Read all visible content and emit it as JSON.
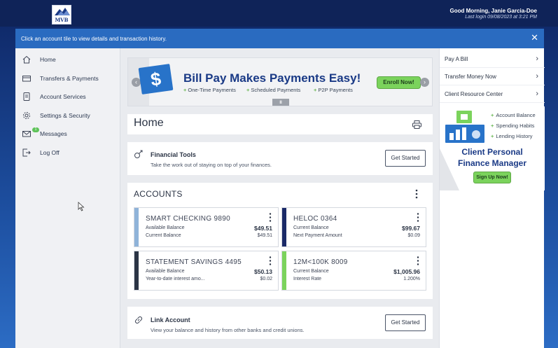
{
  "header": {
    "logo_text": "MVB",
    "greeting": "Good Morning, Janie Garcia-Doe",
    "last_login": "Last login 09/08/2023 at 3:21 PM"
  },
  "notice": {
    "text": "Click an account tile to view details and transaction history.",
    "close_glyph": "✕"
  },
  "sidebar": {
    "items": [
      {
        "label": "Home",
        "icon": "home-icon"
      },
      {
        "label": "Transfers & Payments",
        "icon": "card-icon"
      },
      {
        "label": "Account Services",
        "icon": "document-icon"
      },
      {
        "label": "Settings & Security",
        "icon": "gear-icon"
      },
      {
        "label": "Messages",
        "icon": "envelope-icon",
        "badge": "1"
      },
      {
        "label": "Log Off",
        "icon": "logout-icon"
      }
    ]
  },
  "banner": {
    "title": "Bill Pay Makes Payments Easy!",
    "bullets": [
      "One-Time Payments",
      "Scheduled Payments",
      "P2P Payments"
    ],
    "cta": "Enroll Now!",
    "pause": "II",
    "dollar": "$",
    "prev": "‹",
    "next": "›"
  },
  "home": {
    "title": "Home"
  },
  "financial_tools": {
    "title": "Financial Tools",
    "subtitle": "Take the work out of staying on top of your finances.",
    "button": "Get Started"
  },
  "accounts": {
    "heading": "ACCOUNTS",
    "tiles": [
      {
        "name": "SMART CHECKING 9890",
        "label1": "Available Balance",
        "value1": "$49.51",
        "label2": "Current Balance",
        "value2": "$49.51",
        "color": "#8fb3d9"
      },
      {
        "name": "HELOC 0364",
        "label1": "Current Balance",
        "value1": "$99.67",
        "label2": "Next Payment Amount",
        "value2": "$0.09",
        "color": "#1b2a68"
      },
      {
        "name": "STATEMENT SAVINGS 4495",
        "label1": "Available Balance",
        "value1": "$50.13",
        "label2": "Year-to-date interest amo...",
        "value2": "$0.02",
        "color": "#2b3445"
      },
      {
        "name": "12M<100K 8009",
        "label1": "Current Balance",
        "value1": "$1,005.96",
        "label2": "Interest Rate",
        "value2": "1.200%",
        "color": "#7bd35c"
      }
    ]
  },
  "link_account": {
    "title": "Link Account",
    "subtitle": "View your balance and history from other banks and credit unions.",
    "button": "Get Started"
  },
  "quick_links": [
    {
      "label": "Pay A Bill"
    },
    {
      "label": "Transfer Money Now"
    },
    {
      "label": "Client Resource Center"
    }
  ],
  "pfm_ad": {
    "bullets": [
      "Account Balance",
      "Spending Habits",
      "Lending History"
    ],
    "title_line1": "Client Personal",
    "title_line2": "Finance Manager",
    "cta": "Sign Up Now!"
  },
  "colors": {
    "brand_navy": "#0f2358",
    "notice_blue": "#2a6bc0",
    "accent_green": "#7bd35c"
  }
}
